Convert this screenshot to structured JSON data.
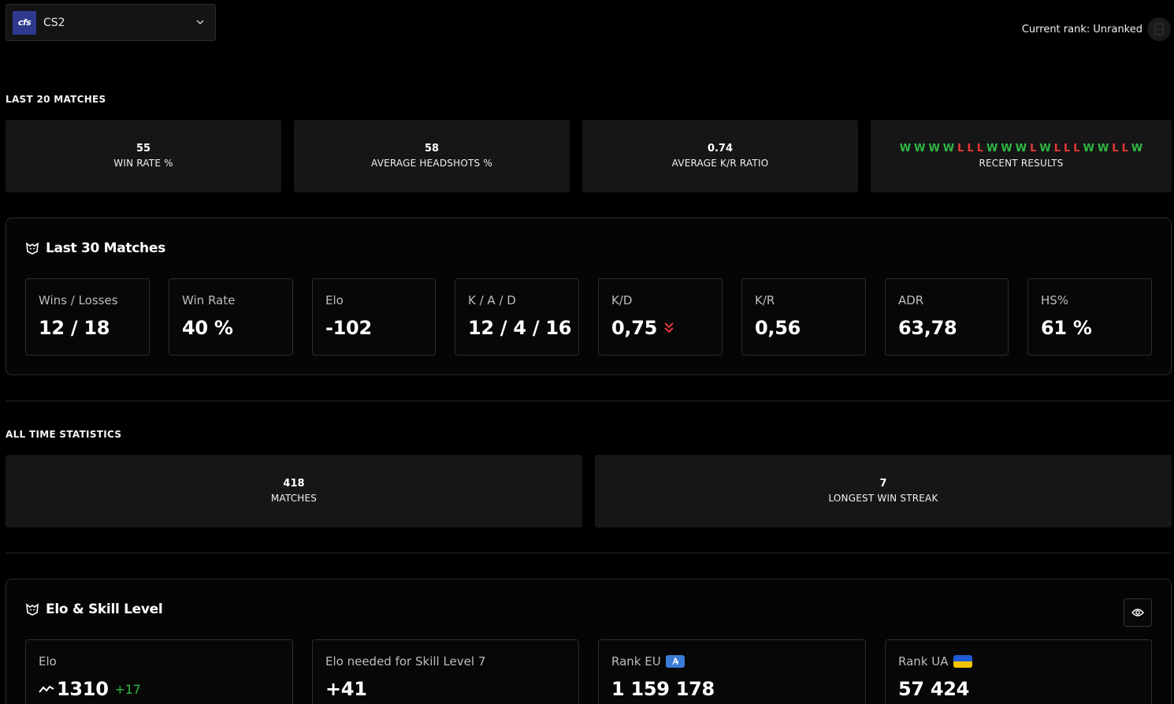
{
  "header": {
    "game_logo_text": "cfs",
    "game_name": "CS2",
    "current_rank": "Current rank: Unranked"
  },
  "last20": {
    "title": "LAST 20 MATCHES",
    "cards": [
      {
        "value": "55",
        "label": "WIN RATE %"
      },
      {
        "value": "58",
        "label": "AVERAGE HEADSHOTS %"
      },
      {
        "value": "0.74",
        "label": "AVERAGE K/R RATIO"
      }
    ],
    "recent_label": "RECENT RESULTS",
    "recent_results": [
      "W",
      "W",
      "W",
      "W",
      "L",
      "L",
      "L",
      "W",
      "W",
      "W",
      "L",
      "W",
      "L",
      "L",
      "L",
      "W",
      "W",
      "L",
      "L",
      "W"
    ]
  },
  "last30": {
    "title": "Last 30 Matches",
    "stats": [
      {
        "label": "Wins / Losses",
        "value": "12 / 18"
      },
      {
        "label": "Win Rate",
        "value": "40 %"
      },
      {
        "label": "Elo",
        "value": "-102"
      },
      {
        "label": "K / A / D",
        "value": "12 / 4 / 16"
      },
      {
        "label": "K/D",
        "value": "0,75"
      },
      {
        "label": "K/R",
        "value": "0,56"
      },
      {
        "label": "ADR",
        "value": "63,78"
      },
      {
        "label": "HS%",
        "value": "61 %"
      }
    ]
  },
  "alltime": {
    "title": "ALL TIME STATISTICS",
    "cards": [
      {
        "value": "418",
        "label": "MATCHES"
      },
      {
        "value": "7",
        "label": "LONGEST WIN STREAK"
      }
    ]
  },
  "elo_skill": {
    "title": "Elo & Skill Level",
    "stats": [
      {
        "label": "Elo",
        "value": "1310",
        "delta": "+17"
      },
      {
        "label": "Elo needed for Skill Level 7",
        "value": "+41"
      },
      {
        "label": "Rank EU",
        "value": "1 159 178"
      },
      {
        "label": "Rank UA",
        "value": "57 424"
      }
    ]
  },
  "colors": {
    "win": "#2fb844",
    "loss": "#e53935",
    "card_bg": "#161616",
    "panel_border": "#2b2b2b"
  }
}
